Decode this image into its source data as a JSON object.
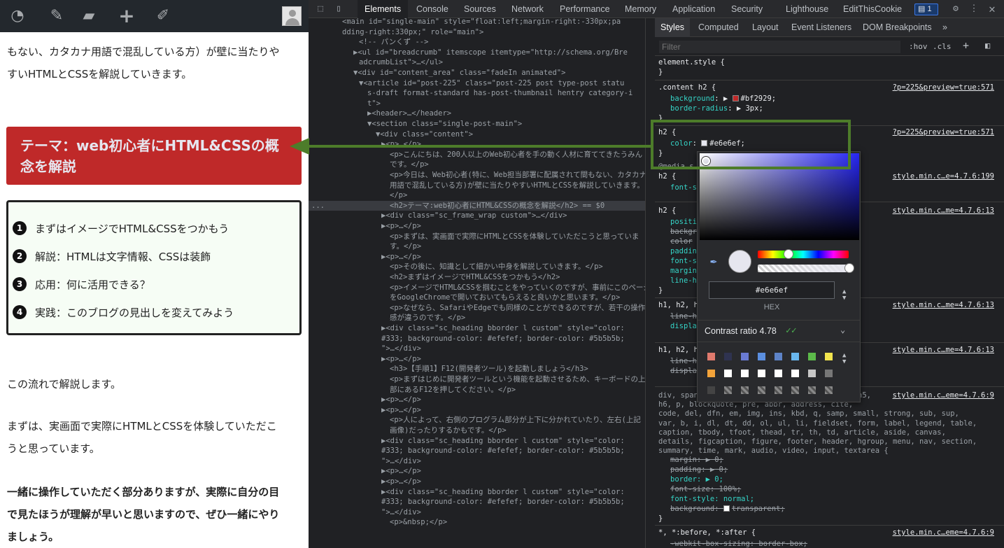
{
  "page": {
    "adminbar": {
      "icons": [
        "dashboard-icon",
        "customize-brush-icon",
        "comments-icon",
        "new-plus-icon",
        "edit-pencil-icon",
        "user-avatar"
      ]
    },
    "intro_line1": "もない、カタカナ用語で混乱している方）が壁に当たりや",
    "intro_line2": "すいHTMLとCSSを解説していきます。",
    "h2_title": "テーマ：web初心者にHTML&CSSの概念を解説",
    "toc": [
      {
        "num": "1",
        "label": "まずはイメージでHTML&CSSをつかもう"
      },
      {
        "num": "2",
        "label": "解説：HTMLは文字情報、CSSは装飾"
      },
      {
        "num": "3",
        "label": "応用：何に活用できる？"
      },
      {
        "num": "4",
        "label": "実践：このブログの見出しを変えてみよう"
      }
    ],
    "p_flow": "この流れで解説します。",
    "p_first1": "まずは、実画面で実際にHTMLとCSSを体験していただこ",
    "p_first2": "うと思っています。",
    "p_bold1": "一緒に操作していただく部分ありますが、実際に自分の目",
    "p_bold2": "で見たほうが理解が早いと思いますので、ぜひ一緒にやり",
    "p_bold3": "ましょう。"
  },
  "devtools": {
    "main_tabs": [
      "Elements",
      "Console",
      "Sources",
      "Network",
      "Performance",
      "Memory",
      "Application",
      "Security",
      "Lighthouse",
      "EditThisCookie"
    ],
    "active_tab": "Elements",
    "issues_count": "1",
    "styles_tabs": [
      "Styles",
      "Computed",
      "Layout",
      "Event Listeners",
      "DOM Breakpoints"
    ],
    "more_tabs": "»",
    "filter_placeholder": "Filter",
    "hov": ":hov",
    "cls": ".cls",
    "dots": "...",
    "elements_lines": [
      "<main id=\"single-main\" style=\"float:left;margin-right:-330px;pa",
      "dding-right:330px;\" role=\"main\">",
      "<!-- パンくず -->",
      "▶<ul id=\"breadcrumb\" itemscope itemtype=\"http://schema.org/Bre",
      "adcrumbList\">…</ul>",
      "▼<div id=\"content_area\" class=\"fadeIn animated\">",
      "▼<article id=\"post-225\" class=\"post-225 post type-post statu",
      "s-draft format-standard has-post-thumbnail hentry category-i",
      "t\">",
      "▶<header>…</header>",
      "▼<section class=\"single-post-main\">",
      "▼<div class=\"content\">",
      "▶<p>…</p>",
      "<p>こんにちは、200人以上のWeb初心者を手の動く人材に育ててきたうみん",
      "です。</p>",
      "<p>今日は、Web初心者(特に、Web担当部署に配属されて間もない、カタカナ",
      "用語で混乱している方)が壁に当たりやすいHTMLとCSSを解説していきます。",
      "</p>",
      "<h2>テーマ:web初心者にHTML&CSSの概念を解説</h2> == $0",
      "▶<div class=\"sc_frame_wrap  custom\">…</div>",
      "▶<p>…</p>",
      "<p>まずは、実画面で実際にHTMLとCSSを体験していただこうと思っていま",
      "す。</p>",
      "▶<p>…</p>",
      "<p>その後に、知識として細かい中身を解説していきます。</p>",
      "<h2>まずはイメージでHTML&CSSをつかもう</h2>",
      "<p>イメージでHTML&CSSを掴むことをやっていくのですが、事前にこのページ",
      "をGoogleChromeで開いておいてもらえると良いかと思います。</p>",
      "<p>なぜなら、SafariやEdgeでも同様のことができるのですが、若干の操作",
      "感が違うのです。</p>",
      "▶<div class=\"sc_heading bborder l custom\" style=\"color:",
      "#333; background-color: #efefef; border-color: #5b5b5b;",
      "\">…</div>",
      "▶<p>…</p>",
      "<h3>【手順1】F12(開発者ツール)を起動しましょう</h3>",
      "<p>まずはじめに開発者ツールという機能を起動させるため、キーボードの上",
      "部にあるF12を押してください。</p>",
      "▶<p>…</p>",
      "▶<p>…</p>",
      "<p>人によって、右側のプログラム部分が上下に分かれていたり、左右(上記",
      "画像)だったりするかもです。</p>",
      "▶<div class=\"sc_heading bborder l custom\" style=\"color:",
      "#333; background-color: #efefef; border-color: #5b5b5b;",
      "\">…</div>",
      "▶<p>…</p>",
      "▶<p>…</p>",
      "▶<div class=\"sc_heading bborder l custom\" style=\"color:",
      "#333; background-color: #efefef; border-color: #5b5b5b;",
      "\">…</div>",
      "<p>&nbsp;</p>"
    ],
    "styles": {
      "element_style": "element.style {",
      "close": "}",
      "rule1_selector": ".content h2 {",
      "rule1_src": "?p=225&preview=true:571",
      "rule1_bg_name": "background",
      "rule1_bg_value": "#bf2929;",
      "rule1_radius_name": "border-radius",
      "rule1_radius_value": "3px;",
      "rule2_selector": "h2 {",
      "rule2_src": "?p=225&preview=true:571",
      "rule2_color_name": "color",
      "rule2_color_value": "#e6e6ef;",
      "media": "@media s",
      "rule3_selector": "h2 {",
      "rule3_src": "style.min.c…e=4.7.6:199",
      "rule3_prop": "font-s",
      "rule4_selector": "h2 {",
      "rule4_src": "style.min.c…me=4.7.6:13",
      "rule4_props": [
        "positi",
        "backgr",
        "color",
        "paddin",
        "font-s",
        "margin",
        "line-h"
      ],
      "rule5_selector": "h1, h2, h",
      "rule5_src": "style.min.c…me=4.7.6:13",
      "rule5_props": [
        "line-h",
        "displa"
      ],
      "rule6_selector": "h1, h2, h",
      "rule6_src": "style.min.c…me=4.7.6:13",
      "rule6_props": [
        "line-h",
        "displa"
      ],
      "rule7_lines": [
        "div, span",
        "h6, p, blockquote, pre, abbr, address, cite,",
        "code, del, dfn, em, img, ins, kbd, q, samp, small, strong, sub, sup,",
        "var, b, i, dl, dt, dd, ol, ul, li, fieldset, form, label, legend, table,",
        "caption, tbody, tfoot, thead, tr, th, td, article, aside, canvas,",
        "details, figcaption, figure, footer, header, hgroup, menu, nav, section,",
        "summary, time, mark, audio, video, input, textarea {"
      ],
      "rule7_sel_tail": "h5,",
      "rule7_src": "style.min.c…eme=4.7.6:9",
      "rule7_margin": "margin: ▶ 0;",
      "rule7_padding": "padding: ▶ 0;",
      "rule7_border": "border: ▶ 0;",
      "rule7_fontsize": "font-size: 100%;",
      "rule7_fontstyle": "font-style: normal;",
      "rule7_bg": "background: ",
      "rule7_bg_value": "transparent;",
      "rule8_selector": "*, *:before, *:after {",
      "rule8_src": "style.min.c…eme=4.7.6:9",
      "rule8_prop": "-webkit-box-sizing: border-box;"
    },
    "color_picker": {
      "hex_value": "#e6e6ef",
      "format_label": "HEX",
      "contrast_label": "Contrast ratio",
      "contrast_value": "4.78",
      "contrast_check": "✓✓",
      "selected_color": "#e6e6ef",
      "hue_color": "#2626f2",
      "palette": [
        "#e07a6d",
        "#2f3350",
        "#6a7bd3",
        "#5b8fe0",
        "#5d83c8",
        "#69b7ee",
        "#5cba4a",
        "#f2e44e",
        "#f2a33a",
        "#ffffff",
        "#ffffff",
        "#ffffff",
        "#ffffff",
        "#ffffff",
        "#c7c7c7",
        "#777777",
        "#444444",
        "checker",
        "checker",
        "checker",
        "checker",
        "checker",
        "checker",
        "checker"
      ]
    }
  },
  "colors": {
    "accent_green": "#4d7c2a",
    "h2_bg": "#bf2929",
    "h2_text": "#e6e6ef"
  }
}
